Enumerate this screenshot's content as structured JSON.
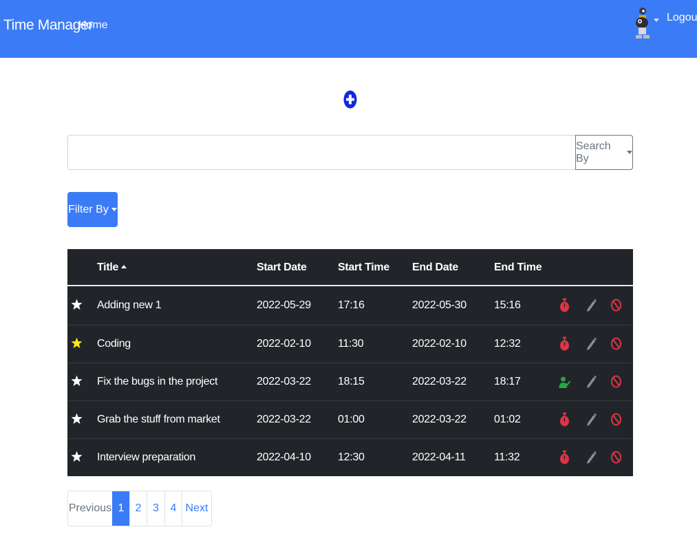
{
  "navbar": {
    "brand": "Time Manager",
    "home_label": "Home",
    "logout_label": "Logout",
    "avatar_icon": "robot-avatar-icon",
    "color": "#3b7bf6"
  },
  "add_button_icon": "plus-circle-icon",
  "search": {
    "value": "",
    "placeholder": "",
    "search_by_label": "Search By"
  },
  "filter_label": "Filter By",
  "table": {
    "headers": {
      "title": "Title",
      "start_date": "Start Date",
      "start_time": "Start Time",
      "end_date": "End Date",
      "end_time": "End Time"
    },
    "sorted_by": "title",
    "sort_direction": "ascending",
    "rows": [
      {
        "favorite": false,
        "title": "Adding new 1",
        "start_date": "2022-05-29",
        "start_time": "17:16",
        "end_date": "2022-05-30",
        "end_time": "15:16",
        "status_icon": "stopwatch-icon"
      },
      {
        "favorite": true,
        "title": "Coding",
        "start_date": "2022-02-10",
        "start_time": "11:30",
        "end_date": "2022-02-10",
        "end_time": "12:32",
        "status_icon": "stopwatch-icon"
      },
      {
        "favorite": false,
        "title": "Fix the bugs in the project",
        "start_date": "2022-03-22",
        "start_time": "18:15",
        "end_date": "2022-03-22",
        "end_time": "18:17",
        "status_icon": "user-check-icon"
      },
      {
        "favorite": false,
        "title": "Grab the stuff from market",
        "start_date": "2022-03-22",
        "start_time": "01:00",
        "end_date": "2022-03-22",
        "end_time": "01:02",
        "status_icon": "stopwatch-icon"
      },
      {
        "favorite": false,
        "title": "Interview preparation",
        "start_date": "2022-04-10",
        "start_time": "12:30",
        "end_date": "2022-04-11",
        "end_time": "11:32",
        "status_icon": "stopwatch-icon"
      }
    ]
  },
  "pagination": {
    "previous": "Previous",
    "pages": [
      "1",
      "2",
      "3",
      "4"
    ],
    "active_page": "1",
    "next": "Next"
  },
  "colors": {
    "primary": "#3b7bf6",
    "table_bg": "#212529",
    "star_favorite": "#ffe619",
    "danger": "#dc3545",
    "success": "#28a745",
    "edit_gray": "#8a8f94"
  }
}
